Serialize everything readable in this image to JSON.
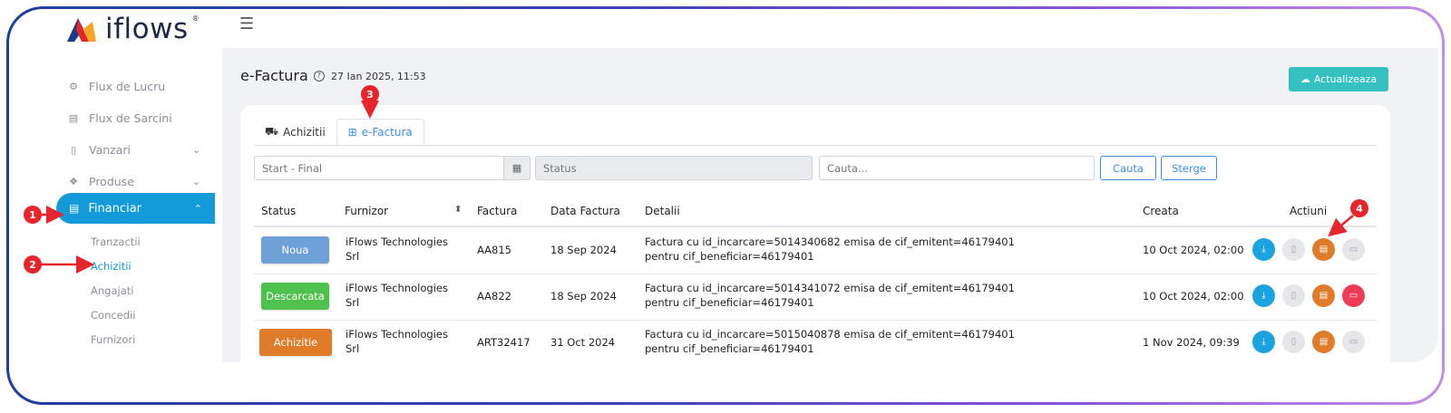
{
  "app": {
    "logo_text": "iflows",
    "logo_reg": "®"
  },
  "sidebar": {
    "items": [
      {
        "label": "Flux de Lucru",
        "icon": "workflow-icon"
      },
      {
        "label": "Flux de Sarcini",
        "icon": "tasks-icon"
      },
      {
        "label": "Vanzari",
        "icon": "invoice-icon"
      },
      {
        "label": "Produse",
        "icon": "boxes-icon"
      },
      {
        "label": "Financiar",
        "icon": "money-icon",
        "active": true
      }
    ],
    "sub_items": [
      "Tranzactii",
      "Achizitii",
      "Angajati",
      "Concedii",
      "Furnizori"
    ],
    "active_sub": "Achizitii"
  },
  "header": {
    "title": "e-Factura",
    "date": "27 Ian 2025, 11:53",
    "update_label": "Actualizeaza"
  },
  "tabs": [
    {
      "label": "Achizitii",
      "icon": "truck-icon"
    },
    {
      "label": "e-Factura",
      "icon": "grid-icon",
      "active": true
    }
  ],
  "filters": {
    "date_placeholder": "Start - Final",
    "status_placeholder": "Status",
    "search_placeholder": "Cauta...",
    "search_label": "Cauta",
    "clear_label": "Sterge"
  },
  "table": {
    "columns": [
      "Status",
      "Furnizor",
      "Factura",
      "Data Factura",
      "Detalii",
      "Creata",
      "Actiuni"
    ],
    "rows": [
      {
        "status": "Noua",
        "status_color": "#6fa0d8",
        "supplier": "iFlows Technologies Srl",
        "invoice": "AA815",
        "date": "18 Sep 2024",
        "details": "Factura cu id_incarcare=5014340682 emisa de cif_emitent=46179401 pentru cif_beneficiar=46179401",
        "created": "10 Oct 2024, 02:00",
        "msg_red": false
      },
      {
        "status": "Descarcata",
        "status_color": "#4fc14f",
        "supplier": "iFlows Technologies Srl",
        "invoice": "AA822",
        "date": "18 Sep 2024",
        "details": "Factura cu id_incarcare=5014341072 emisa de cif_emitent=46179401 pentru cif_beneficiar=46179401",
        "created": "10 Oct 2024, 02:00",
        "msg_red": true
      },
      {
        "status": "Achizitie",
        "status_color": "#e07b2a",
        "supplier": "iFlows Technologies Srl",
        "invoice": "ART32417",
        "date": "31 Oct 2024",
        "details": "Factura cu id_incarcare=5015040878 emisa de cif_emitent=46179401 pentru cif_beneficiar=46179401",
        "created": "1 Nov 2024, 09:39",
        "msg_red": false
      }
    ]
  },
  "annotations": [
    "1",
    "2",
    "3",
    "4"
  ],
  "colors": {
    "accent": "#129bd8",
    "marker": "#e5242b"
  }
}
